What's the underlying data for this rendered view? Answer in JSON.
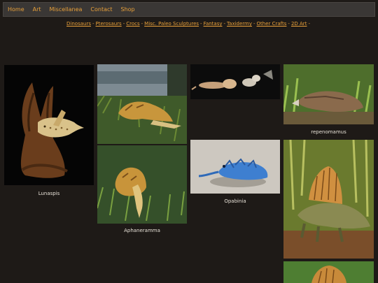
{
  "nav": {
    "items": [
      "Home",
      "Art",
      "Miscellanea",
      "Contact",
      "Shop"
    ]
  },
  "categories": {
    "items": [
      "Dinosaurs",
      "Pterosaurs",
      "Crocs",
      "Misc. Paleo Sculptures",
      "Fantasy",
      "Taxidermy",
      "Other Crafts",
      "2D Art"
    ],
    "separator": "-"
  },
  "gallery": {
    "lunaspis_caption": "Lunaspis",
    "aphaneramma_caption": "Aphaneramma",
    "opabinia_caption": "Opabinia",
    "repenomamus_caption": "repenomamus"
  },
  "colors": {
    "background": "#1e1a17",
    "nav_bar": "#3a3735",
    "link": "#e8a03a",
    "caption": "#e8e2d8"
  }
}
